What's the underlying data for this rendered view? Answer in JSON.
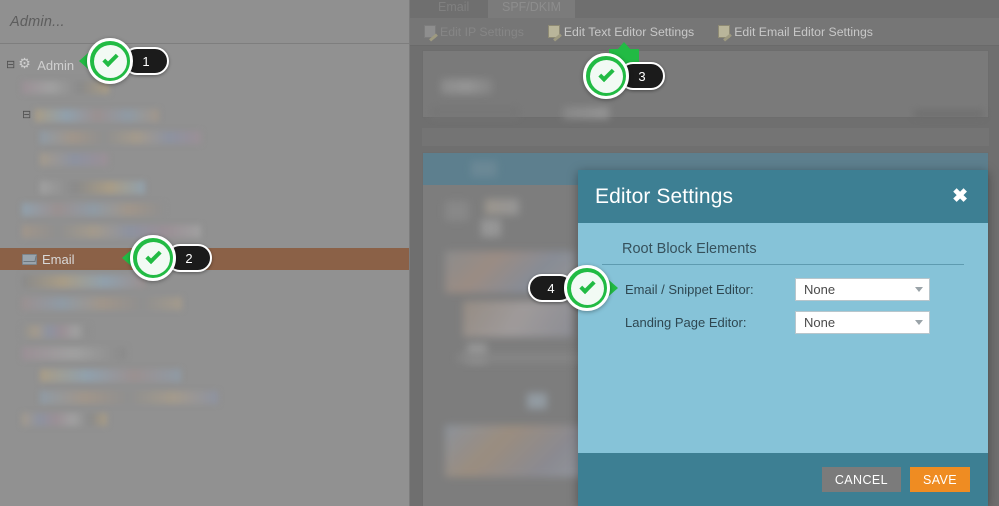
{
  "sidebar": {
    "header_title": "Admin...",
    "items": [
      {
        "label": "Admin",
        "icon": "gear-icon",
        "level": 0,
        "selected": false,
        "redacted": false,
        "expander": "⊟"
      },
      {
        "label": "",
        "icon": "",
        "level": 1,
        "selected": false,
        "redacted": true,
        "expander": ""
      },
      {
        "label": "",
        "icon": "",
        "level": 1,
        "selected": false,
        "redacted": true,
        "expander": "⊟"
      },
      {
        "label": "",
        "icon": "",
        "level": 2,
        "selected": false,
        "redacted": true,
        "expander": ""
      },
      {
        "label": "",
        "icon": "",
        "level": 2,
        "selected": false,
        "redacted": true,
        "expander": ""
      },
      {
        "label": "",
        "icon": "",
        "level": 2,
        "selected": false,
        "redacted": true,
        "expander": ""
      },
      {
        "label": "",
        "icon": "",
        "level": 1,
        "selected": false,
        "redacted": true,
        "expander": ""
      },
      {
        "label": "",
        "icon": "",
        "level": 1,
        "selected": false,
        "redacted": true,
        "expander": ""
      },
      {
        "label": "Email",
        "icon": "mail-icon",
        "level": 1,
        "selected": true,
        "redacted": false,
        "expander": ""
      },
      {
        "label": "",
        "icon": "",
        "level": 1,
        "selected": false,
        "redacted": true,
        "expander": ""
      },
      {
        "label": "",
        "icon": "",
        "level": 1,
        "selected": false,
        "redacted": true,
        "expander": ""
      },
      {
        "label": "",
        "icon": "",
        "level": 1,
        "selected": false,
        "redacted": true,
        "expander": ""
      },
      {
        "label": "",
        "icon": "",
        "level": 1,
        "selected": false,
        "redacted": true,
        "expander": ""
      },
      {
        "label": "",
        "icon": "",
        "level": 2,
        "selected": false,
        "redacted": true,
        "expander": ""
      },
      {
        "label": "",
        "icon": "",
        "level": 2,
        "selected": false,
        "redacted": true,
        "expander": ""
      },
      {
        "label": "",
        "icon": "",
        "level": 1,
        "selected": false,
        "redacted": true,
        "expander": ""
      }
    ]
  },
  "main": {
    "tabs": [
      {
        "label": "Email",
        "active": false
      },
      {
        "label": "SPF/DKIM",
        "active": true
      }
    ],
    "toolbar": [
      {
        "label": "Edit IP Settings",
        "icon": "edit-page-icon",
        "disabled": true
      },
      {
        "label": "Edit Text Editor Settings",
        "icon": "edit-page-icon",
        "disabled": false
      },
      {
        "label": "Edit Email Editor Settings",
        "icon": "edit-page-icon",
        "disabled": false
      }
    ]
  },
  "modal": {
    "title": "Editor Settings",
    "close_label": "✖",
    "section_title": "Root Block Elements",
    "fields": [
      {
        "label": "Email / Snippet Editor:",
        "value": "None"
      },
      {
        "label": "Landing Page Editor:",
        "value": "None"
      }
    ],
    "cancel_label": "CANCEL",
    "save_label": "SAVE"
  },
  "callouts": [
    {
      "number": "1",
      "direction": "left"
    },
    {
      "number": "2",
      "direction": "left"
    },
    {
      "number": "3",
      "direction": "up"
    },
    {
      "number": "4",
      "direction": "right"
    }
  ],
  "colors": {
    "accent_teal": "#3d7f93",
    "body_blue": "#86c3d8",
    "save_orange": "#ef8c22",
    "callout_green": "#22bb44",
    "selected_row": "#8b6147"
  }
}
